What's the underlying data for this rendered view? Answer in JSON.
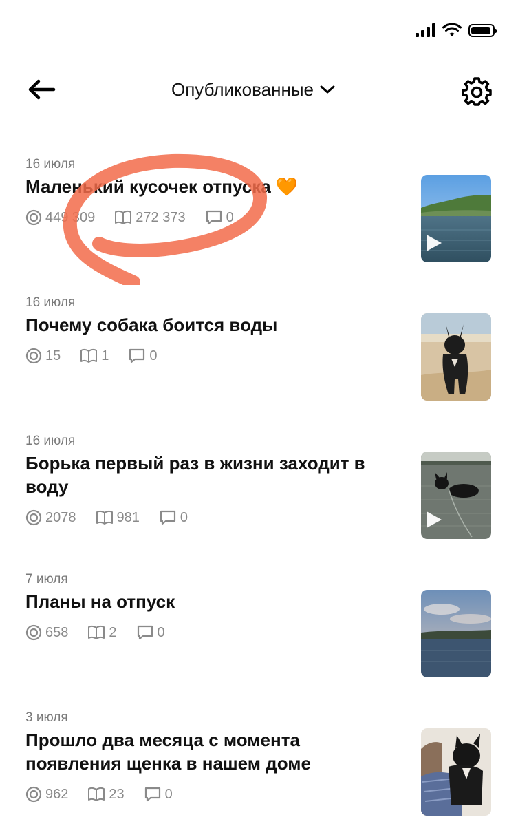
{
  "status_bar": {
    "time": "",
    "battery_level": 0.82
  },
  "header": {
    "title": "Опубликованные",
    "back_icon": "arrow-left-icon",
    "settings_icon": "gear-icon"
  },
  "colors": {
    "annotation": "#f26b4a",
    "heart": "#f5a23a"
  },
  "posts": [
    {
      "date": "16 июля",
      "title": "Маленький кусочек отпуска",
      "views": "449 309",
      "reads": "272 373",
      "comments": "0",
      "video": true,
      "heart_emoji": "🧡"
    },
    {
      "date": "16 июля",
      "title": "Почему собака боится воды",
      "views": "15",
      "reads": "1",
      "comments": "0",
      "video": false
    },
    {
      "date": "16 июля",
      "title": "Борька первый раз в жизни заходит в воду",
      "views": "2078",
      "reads": "981",
      "comments": "0",
      "video": true
    },
    {
      "date": "7 июля",
      "title": "Планы на отпуск",
      "views": "658",
      "reads": "2",
      "comments": "0",
      "video": false
    },
    {
      "date": "3 июля",
      "title": "Прошло два месяца с момента появления щенка в нашем доме",
      "views": "962",
      "reads": "23",
      "comments": "0",
      "video": false
    }
  ]
}
